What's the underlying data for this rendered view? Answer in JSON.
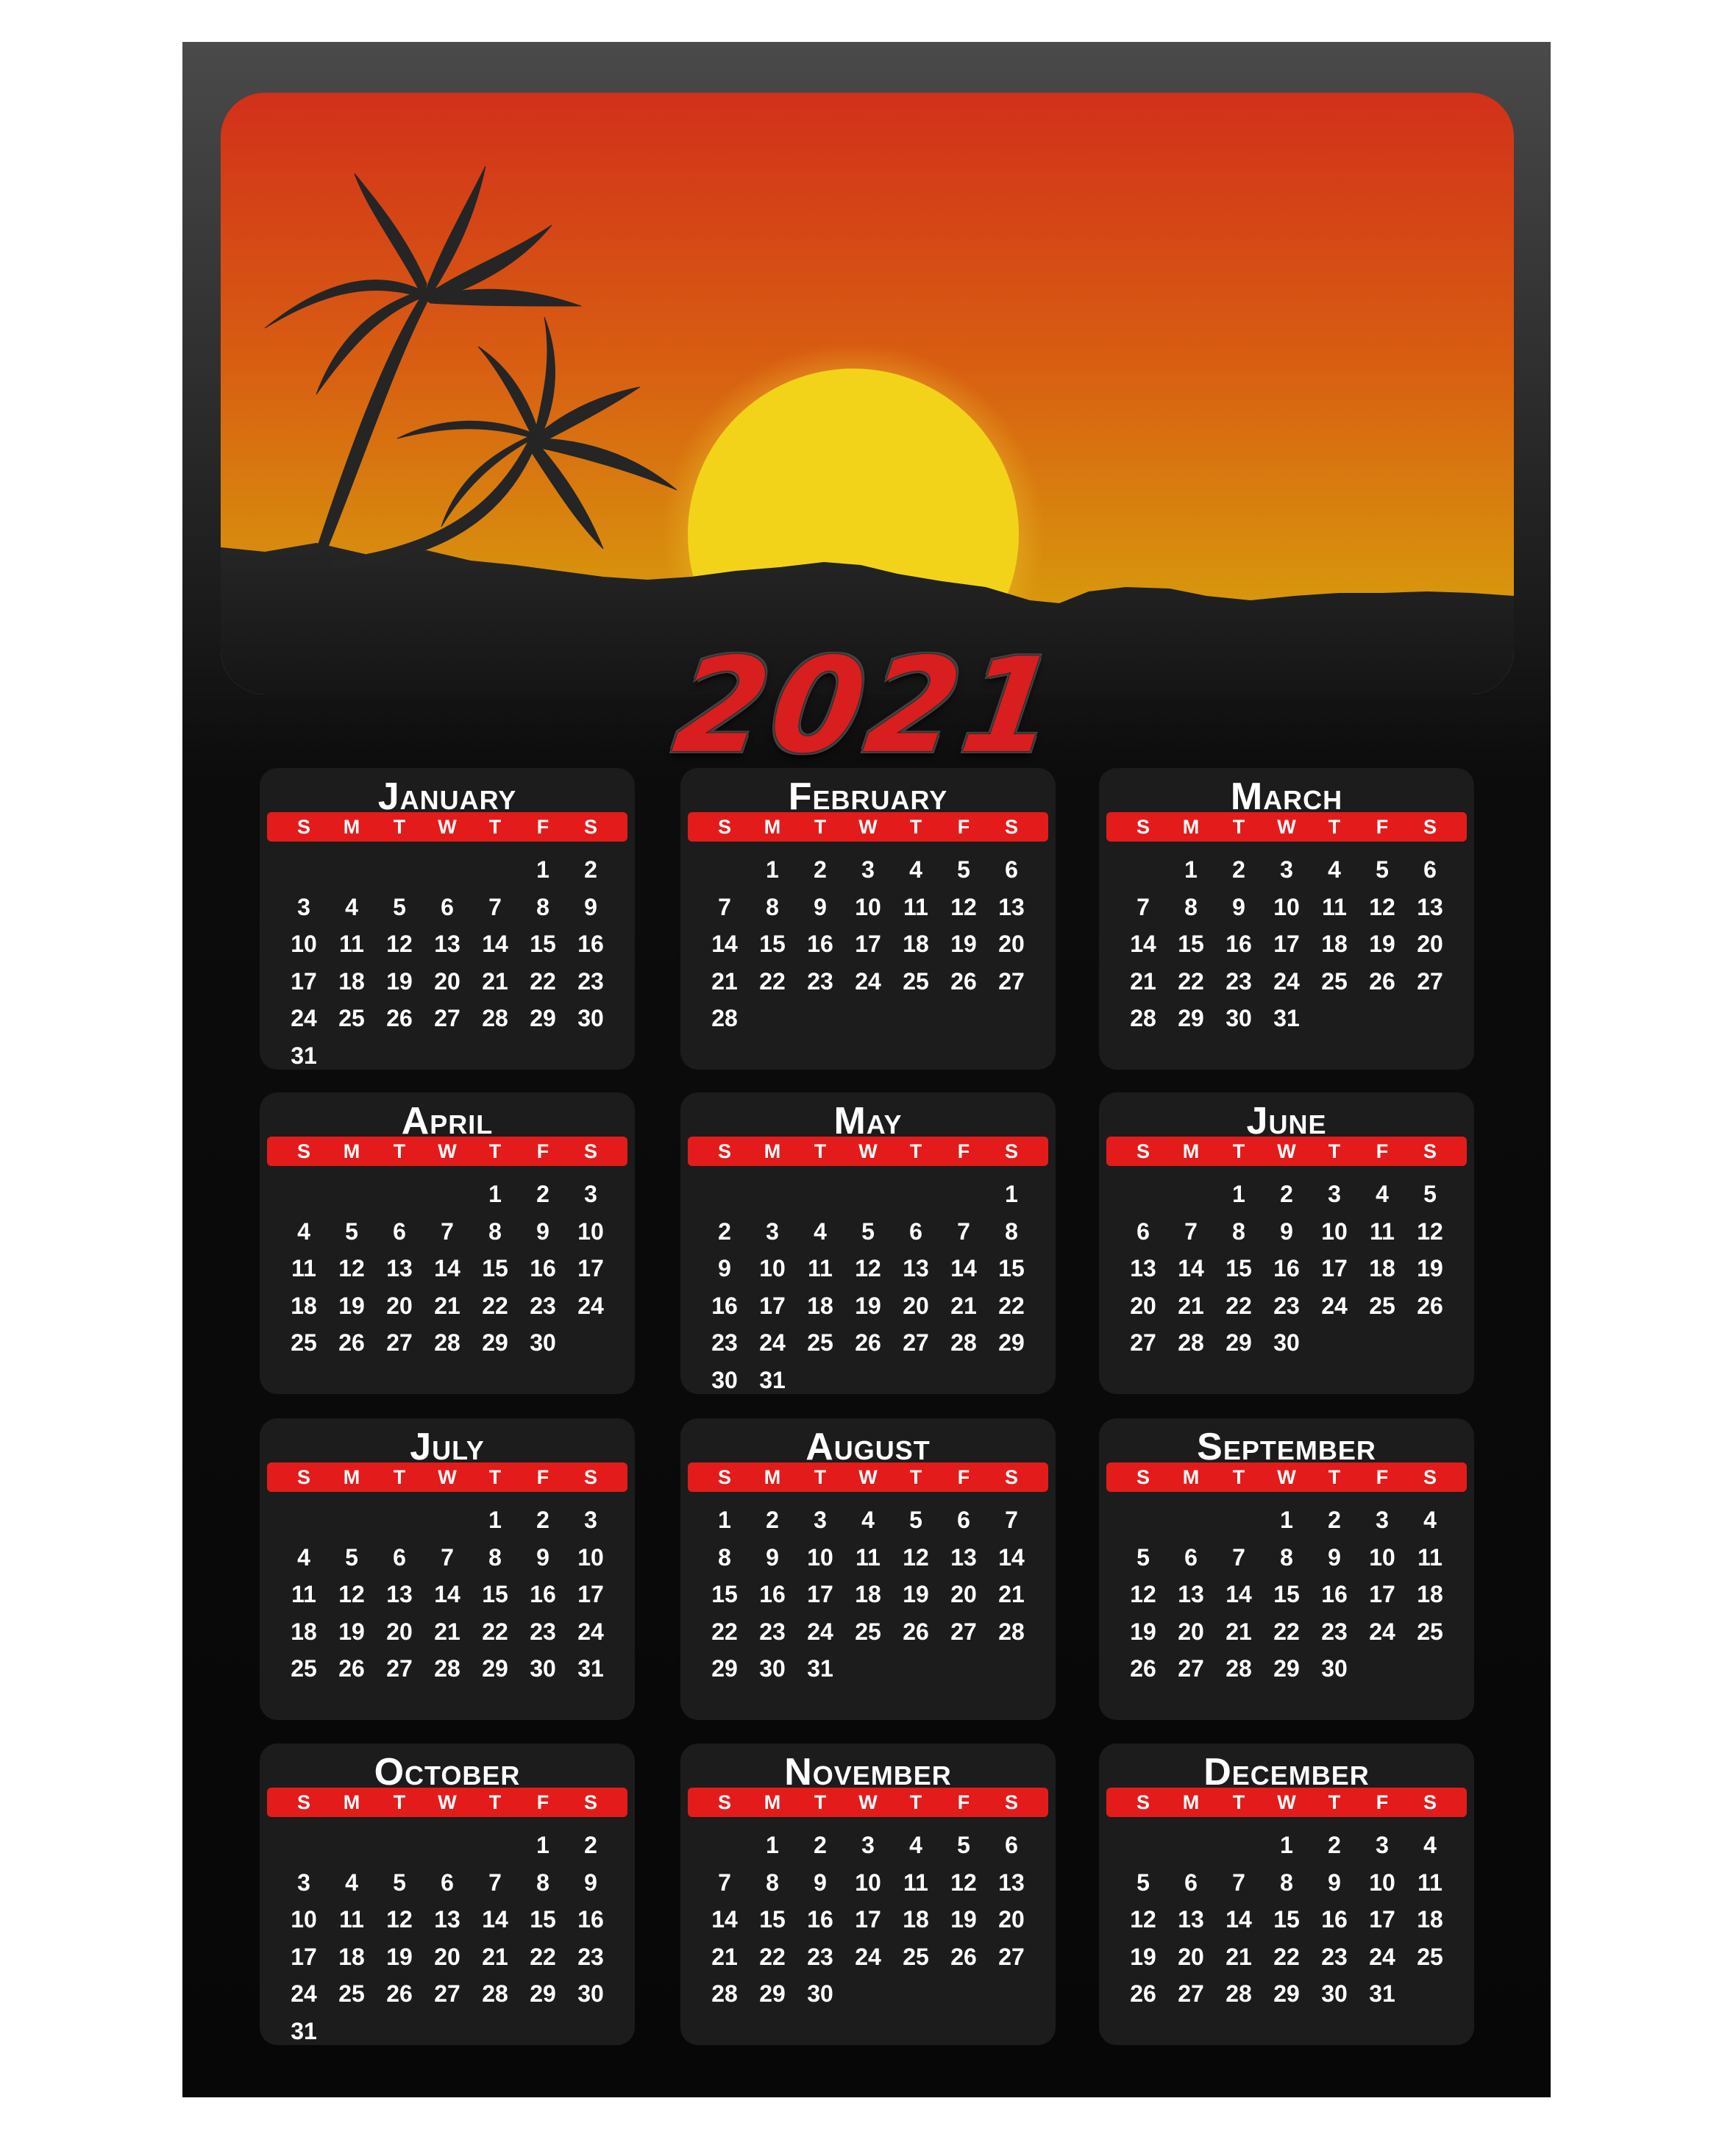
{
  "calendar": {
    "year": "2021",
    "weekdays": [
      "S",
      "M",
      "T",
      "W",
      "T",
      "F",
      "S"
    ],
    "months": [
      {
        "name": "January",
        "start": 5,
        "days": 31
      },
      {
        "name": "February",
        "start": 1,
        "days": 28
      },
      {
        "name": "March",
        "start": 1,
        "days": 31
      },
      {
        "name": "April",
        "start": 4,
        "days": 30
      },
      {
        "name": "May",
        "start": 6,
        "days": 31
      },
      {
        "name": "June",
        "start": 2,
        "days": 30
      },
      {
        "name": "July",
        "start": 4,
        "days": 31
      },
      {
        "name": "August",
        "start": 0,
        "days": 31
      },
      {
        "name": "September",
        "start": 3,
        "days": 30
      },
      {
        "name": "October",
        "start": 5,
        "days": 31
      },
      {
        "name": "November",
        "start": 1,
        "days": 30
      },
      {
        "name": "December",
        "start": 3,
        "days": 31
      }
    ]
  },
  "colors": {
    "accent": "#e41b1b",
    "panel": "#1c1c1c",
    "sky_top": "#d3311a",
    "sky_bottom": "#d9a90b",
    "sun": "#f3d31a"
  },
  "icons": [
    "palm-tree-icon",
    "sun-icon",
    "hills-icon"
  ]
}
